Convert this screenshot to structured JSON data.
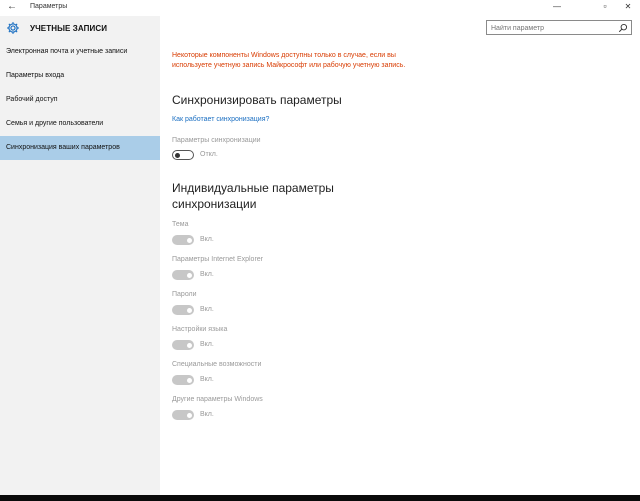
{
  "window": {
    "title": "Параметры",
    "back_glyph": "←",
    "minimize_glyph": "—",
    "maximize_glyph": "▫",
    "close_glyph": "✕"
  },
  "sidebar": {
    "header_title": "УЧЕТНЫЕ ЗАПИСИ",
    "header_icon": "gear-icon",
    "items": [
      {
        "label": "Электронная почта и учетные записи"
      },
      {
        "label": "Параметры входа"
      },
      {
        "label": "Рабочий доступ"
      },
      {
        "label": "Семья и другие пользователи"
      },
      {
        "label": "Синхронизация ваших параметров",
        "selected": true
      }
    ]
  },
  "search": {
    "placeholder": "Найти параметр",
    "icon": "search-icon"
  },
  "main": {
    "warning": "Некоторые компоненты Windows доступны только в случае, если вы используете учетную запись Майкрософт или рабочую учетную запись.",
    "sync_heading": "Синхронизировать параметры",
    "how_link": "Как работает синхронизация?",
    "sync_settings": {
      "label": "Параметры синхронизации",
      "state": "Откл.",
      "on": false
    },
    "individual_heading_line1": "Индивидуальные параметры",
    "individual_heading_line2": "синхронизации",
    "individual": [
      {
        "label": "Тема",
        "state": "Вкл.",
        "on": true
      },
      {
        "label": "Параметры Internet Explorer",
        "state": "Вкл.",
        "on": true
      },
      {
        "label": "Пароли",
        "state": "Вкл.",
        "on": true
      },
      {
        "label": "Настройки языка",
        "state": "Вкл.",
        "on": true
      },
      {
        "label": "Специальные возможности",
        "state": "Вкл.",
        "on": true
      },
      {
        "label": "Другие параметры Windows",
        "state": "Вкл.",
        "on": true
      }
    ]
  },
  "colors": {
    "accent": "#1b6fc2",
    "warning": "#d83b01",
    "selected_bg": "#aacde8",
    "sidebar_bg": "#f2f2f2"
  }
}
